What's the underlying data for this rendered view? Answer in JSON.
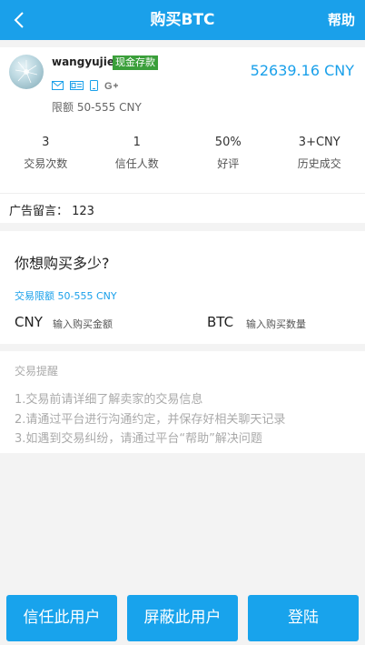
{
  "header": {
    "title": "购买BTC",
    "help": "帮助"
  },
  "seller": {
    "username": "wangyujie",
    "badge": "现金存款",
    "limit_text": "限额 50-555 CNY",
    "price": "52639.16 CNY",
    "verify_icons": [
      "email-icon",
      "id-card-icon",
      "phone-icon",
      "google-plus-icon"
    ]
  },
  "stats": [
    {
      "value": "3",
      "label": "交易次数"
    },
    {
      "value": "1",
      "label": "信任人数"
    },
    {
      "value": "50%",
      "label": "好评"
    },
    {
      "value": "3+CNY",
      "label": "历史成交"
    }
  ],
  "ad_message": "广告留言：  123",
  "buy": {
    "question": "你想购买多少?",
    "range": "交易限额 50-555 CNY",
    "cny_label": "CNY",
    "cny_placeholder": "输入购买金额",
    "btc_label": "BTC",
    "btc_placeholder": "输入购买数量"
  },
  "tips": {
    "title": "交易提醒",
    "items": [
      "1.交易前请详细了解卖家的交易信息",
      "2.请通过平台进行沟通约定，并保存好相关聊天记录",
      "3.如遇到交易纠纷，请通过平台“帮助”解决问题"
    ]
  },
  "buttons": {
    "trust": "信任此用户",
    "block": "屏蔽此用户",
    "login": "登陆"
  },
  "colors": {
    "accent": "#1aa0ea",
    "badge": "#3a9f3a",
    "background": "#f3f3f3"
  }
}
